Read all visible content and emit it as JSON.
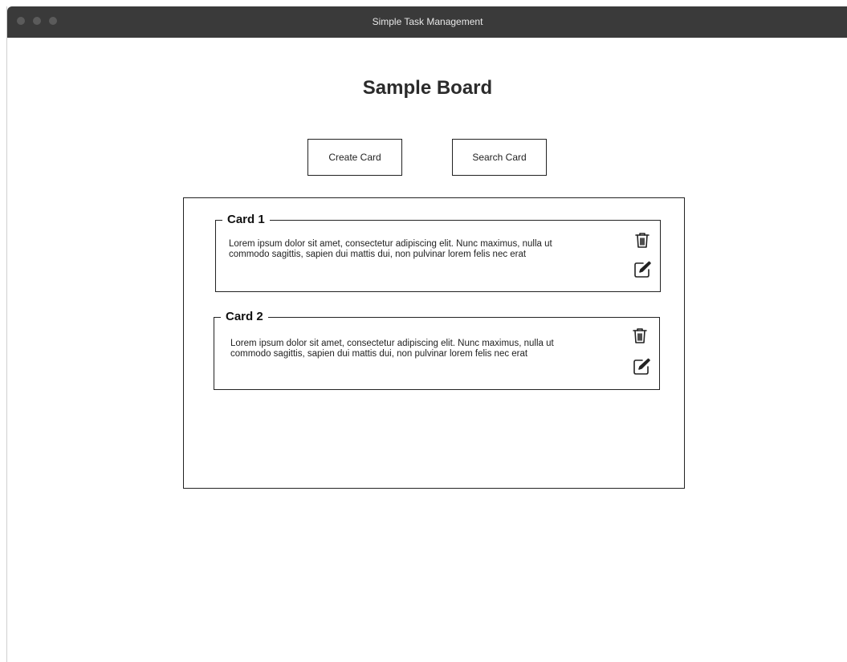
{
  "window": {
    "title": "Simple Task Management"
  },
  "board": {
    "title": "Sample Board"
  },
  "toolbar": {
    "create_label": "Create Card",
    "search_label": "Search Card"
  },
  "cards": [
    {
      "title": "Card 1",
      "body": "Lorem ipsum dolor sit amet, consectetur adipiscing elit. Nunc maximus, nulla ut commodo sagittis, sapien dui mattis dui, non pulvinar lorem felis nec erat",
      "icons": [
        "trash-icon",
        "edit-icon"
      ]
    },
    {
      "title": "Card 2",
      "body": "Lorem ipsum dolor sit amet, consectetur adipiscing elit. Nunc maximus, nulla ut commodo sagittis, sapien dui mattis dui, non pulvinar lorem felis nec erat",
      "icons": [
        "trash-icon",
        "edit-icon"
      ]
    }
  ],
  "colors": {
    "titlebar": "#3a3a3a",
    "titlebar_text": "#e8e8e8",
    "traffic_light": "#5b5b5b",
    "border": "#222222"
  }
}
